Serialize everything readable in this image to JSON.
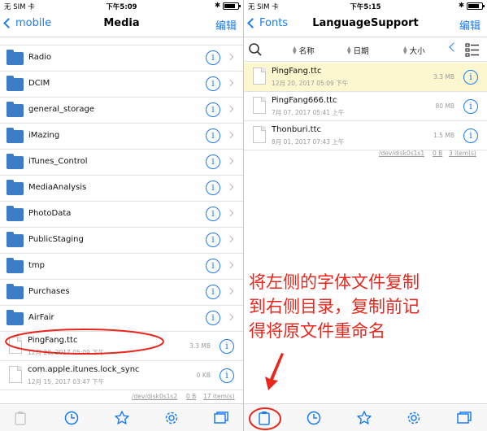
{
  "left": {
    "status": {
      "carrier": "无 SIM 卡",
      "time": "下午5:09"
    },
    "nav": {
      "back": "mobile",
      "title": "Media",
      "edit": "编辑"
    },
    "folders": [
      {
        "name": "Radio"
      },
      {
        "name": "DCIM"
      },
      {
        "name": "general_storage"
      },
      {
        "name": "iMazing"
      },
      {
        "name": "iTunes_Control"
      },
      {
        "name": "MediaAnalysis"
      },
      {
        "name": "PhotoData"
      },
      {
        "name": "PublicStaging"
      },
      {
        "name": "tmp"
      },
      {
        "name": "Purchases"
      },
      {
        "name": "AirFair"
      }
    ],
    "files": [
      {
        "name": "PingFang.ttc",
        "date": "12月 20, 2017 05:09 下午",
        "size": "3.3 MB"
      },
      {
        "name": "com.apple.itunes.lock_sync",
        "date": "12月 15, 2017 03:47 下午",
        "size": "0 KB"
      }
    ],
    "disk": {
      "path": "/dev/disk0s1s2",
      "size": "0 B",
      "count": "17 item(s)"
    }
  },
  "right": {
    "status": {
      "carrier": "无 SIM 卡",
      "time": "下午5:15"
    },
    "nav": {
      "back": "Fonts",
      "title": "LanguageSupport",
      "edit": "编辑"
    },
    "sort": {
      "name": "名称",
      "date": "日期",
      "size": "大小"
    },
    "files": [
      {
        "name": "PingFang.ttc",
        "date": "12月 20, 2017 05:09 下午",
        "size": "3.3 MB",
        "highlight": true
      },
      {
        "name": "PingFang666.ttc",
        "date": "7月 07, 2017 05:41 上午",
        "size": "80 MB"
      },
      {
        "name": "Thonburi.ttc",
        "date": "8月 01, 2017 07:43 上午",
        "size": "1.5 MB"
      }
    ],
    "disk": {
      "path": "/dev/disk0s1s1",
      "size": "0 B",
      "count": "3 item(s)"
    }
  },
  "annotation": {
    "lines": [
      "将左侧的字体文件复制",
      "到右侧目录，复制前记",
      "得将原文件重命名"
    ],
    "color": "#e8261c"
  },
  "colors": {
    "accent": "#1a7cf5",
    "folder": "#3d7dc8",
    "highlight": "#fdf7cf"
  }
}
